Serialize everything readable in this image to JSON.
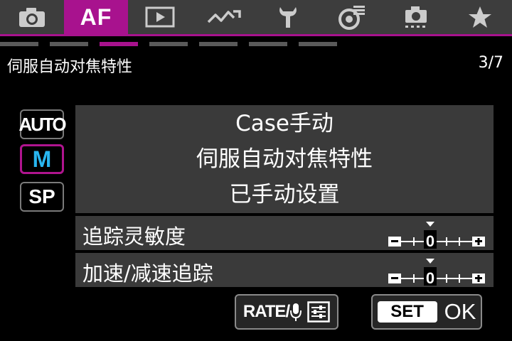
{
  "tabs": [
    {
      "icon": "camera-icon"
    },
    {
      "icon": "af-icon",
      "label": "AF",
      "active": true
    },
    {
      "icon": "playback-icon"
    },
    {
      "icon": "wireless-icon"
    },
    {
      "icon": "wrench-icon"
    },
    {
      "icon": "custom-function-icon"
    },
    {
      "icon": "sensor-cleaning-icon"
    },
    {
      "icon": "star-icon"
    }
  ],
  "page_indicator": {
    "current": 3,
    "total": 7
  },
  "header": {
    "title": "伺服自动对焦特性",
    "page": "3/7"
  },
  "modes": [
    {
      "label": "AUTO",
      "selected": false
    },
    {
      "label": "M",
      "selected": true
    },
    {
      "label": "SP",
      "selected": false
    }
  ],
  "description": {
    "line1": "Case手动",
    "line2": "伺服自动对焦特性",
    "line3": "已手动设置"
  },
  "params": [
    {
      "label": "追踪灵敏度",
      "value": "0"
    },
    {
      "label": "加速/减速追踪",
      "value": "0"
    }
  ],
  "footer": {
    "rate_label": "RATE/",
    "set_label": "SET",
    "ok_label": "OK"
  },
  "colors": {
    "accent": "#a8128e",
    "selected_text": "#29b6f0",
    "tab_bg": "#3d3d3d",
    "panel_bg": "#3a3a3a"
  }
}
